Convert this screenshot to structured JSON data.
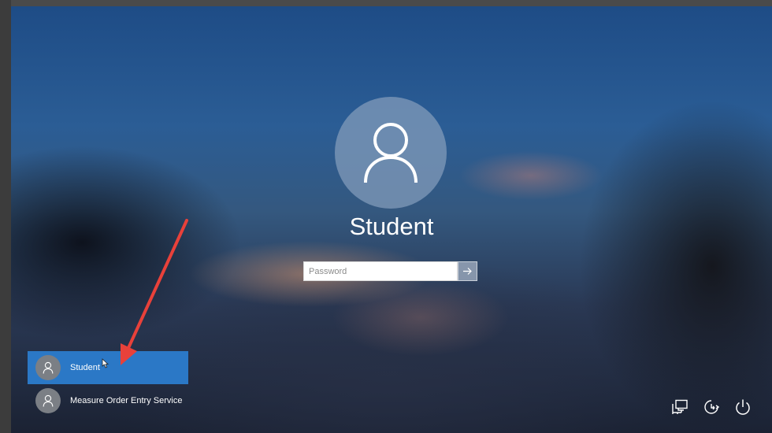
{
  "login": {
    "username": "Student",
    "password_placeholder": "Password"
  },
  "user_list": [
    {
      "name": "Student",
      "selected": true
    },
    {
      "name": "Measure Order Entry Service",
      "selected": false
    }
  ],
  "system_icons": [
    "network-icon",
    "ease-of-access-icon",
    "power-icon"
  ],
  "colors": {
    "selected_user_bg": "#2b78c6",
    "annotation_arrow": "#e8413a"
  }
}
